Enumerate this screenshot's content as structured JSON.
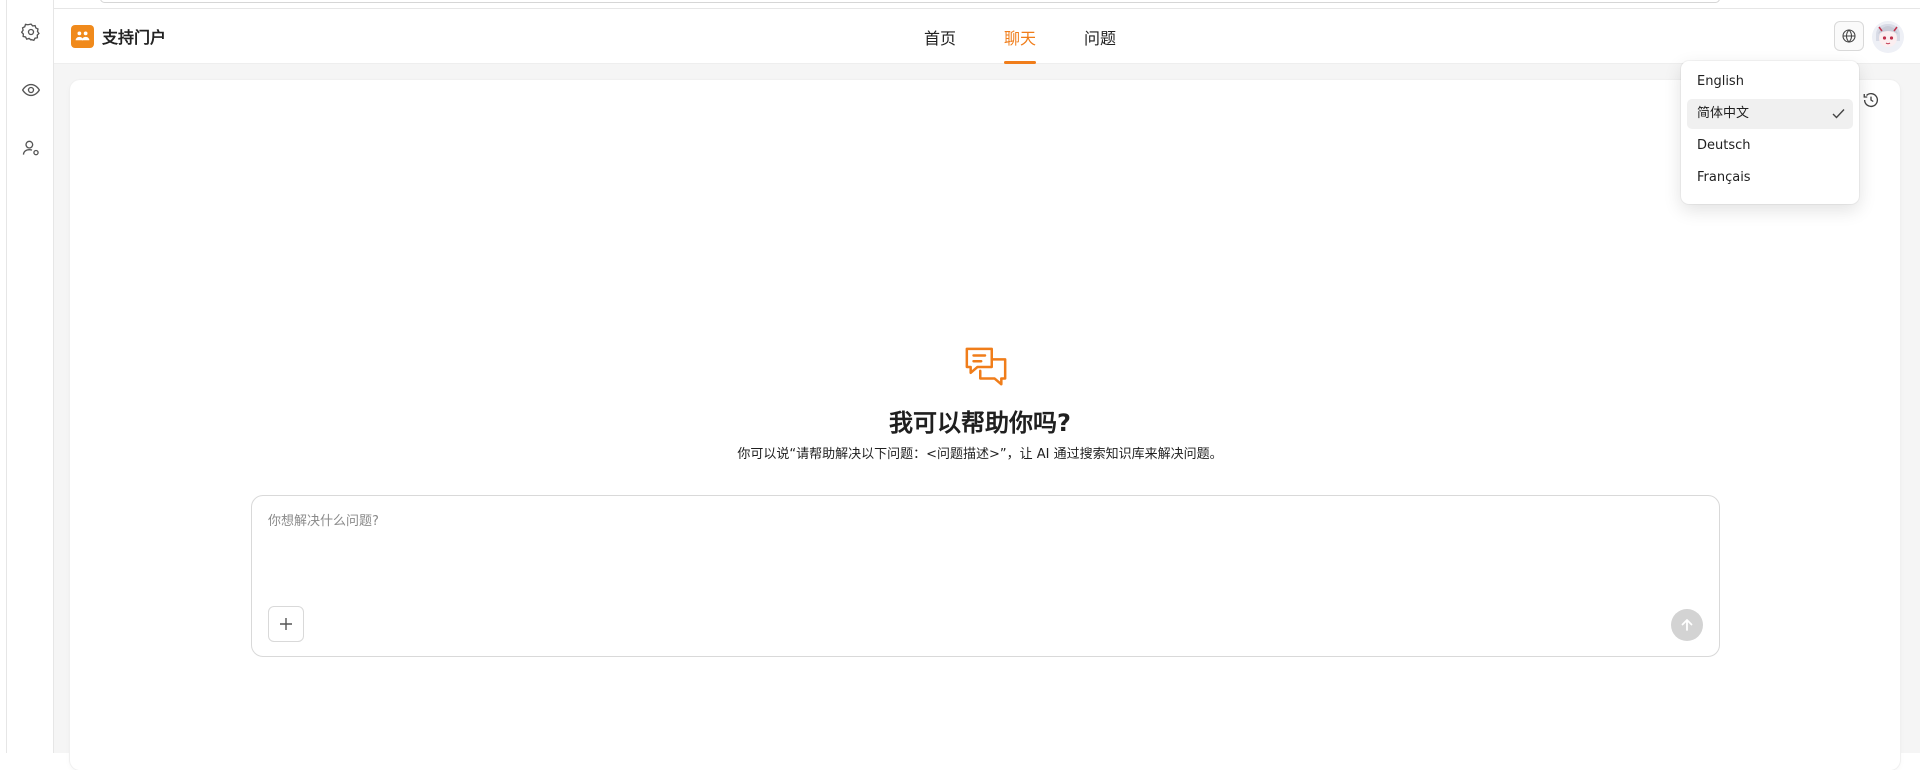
{
  "app": {
    "brand_title": "支持门户",
    "accent_color": "#f07d1a"
  },
  "rail": {
    "items": [
      {
        "icon": "gear-icon"
      },
      {
        "icon": "eye-icon"
      },
      {
        "icon": "user-settings-icon"
      }
    ]
  },
  "nav": {
    "items": [
      {
        "label": "首页",
        "active": false
      },
      {
        "label": "聊天",
        "active": true
      },
      {
        "label": "问题",
        "active": false
      }
    ]
  },
  "language_menu": {
    "options": [
      {
        "label": "English",
        "selected": false
      },
      {
        "label": "简体中文",
        "selected": true
      },
      {
        "label": "Deutsch",
        "selected": false
      },
      {
        "label": "Français",
        "selected": false
      }
    ]
  },
  "chat": {
    "title": "我可以帮助你吗?",
    "subtitle": "你可以说“请帮助解决以下问题：<问题描述>”，让 AI 通过搜索知识库来解决问题。",
    "input_placeholder": "你想解决什么问题?",
    "input_value": ""
  }
}
